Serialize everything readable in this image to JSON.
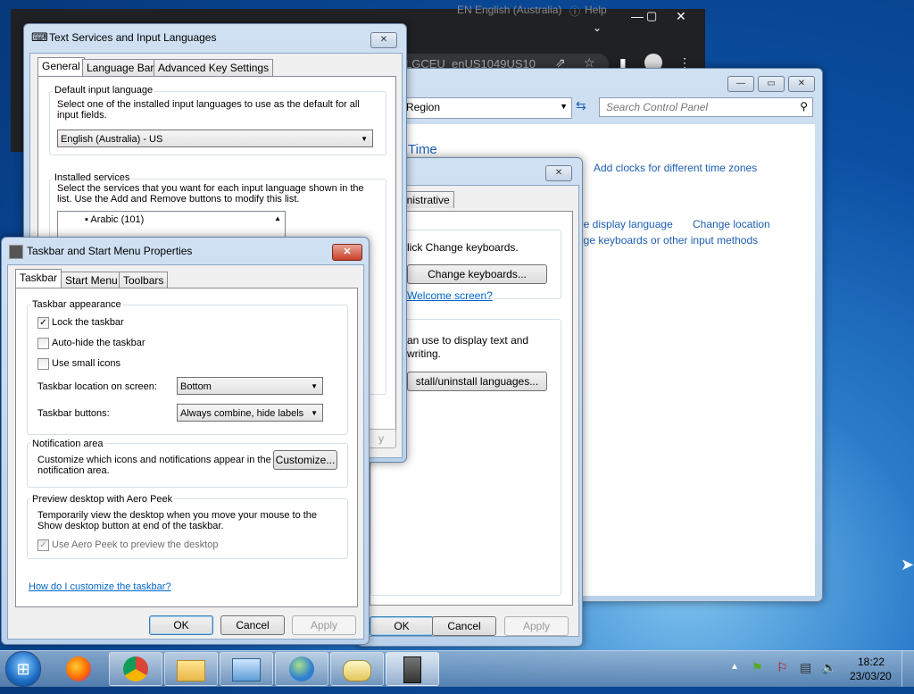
{
  "browser": {
    "language_indicator": "EN English (Australia)",
    "help_label": "Help",
    "url_fragment": "LGCEU_enUS1049US10"
  },
  "control_panel": {
    "address": "Region",
    "search_placeholder": "Search Control Panel",
    "heading": "Time",
    "links": {
      "add_clocks": "Add clocks for different time zones",
      "change_display_language": "ge display language",
      "change_location": "Change location",
      "change_keyboards": "nge keyboards or other input methods"
    }
  },
  "region_dialog": {
    "tab_partial": "inistrative",
    "text1": "lick Change keyboards.",
    "change_keyboards_btn": "Change keyboards...",
    "welcome_link": "Welcome screen?",
    "text2_line1": "an use to display text and",
    "text2_line2": "writing.",
    "install_btn": "stall/uninstall languages...",
    "ok": "OK",
    "cancel": "Cancel",
    "apply": "Apply"
  },
  "text_services": {
    "title": "Text Services and Input Languages",
    "tabs": [
      "General",
      "Language Bar",
      "Advanced Key Settings"
    ],
    "default_group": "Default input language",
    "default_desc": "Select one of the installed input languages to use as the default for all input fields.",
    "default_value": "English (Australia) - US",
    "installed_group": "Installed services",
    "installed_desc": "Select the services that you want for each input language shown in the list. Use the Add and Remove buttons to modify this list.",
    "list_item": "Arabic (101)",
    "apply_partial": "y"
  },
  "taskbar_props": {
    "title": "Taskbar and Start Menu Properties",
    "tabs": [
      "Taskbar",
      "Start Menu",
      "Toolbars"
    ],
    "appearance_group": "Taskbar appearance",
    "lock": "Lock the taskbar",
    "autohide": "Auto-hide the taskbar",
    "small_icons": "Use small icons",
    "location_label": "Taskbar location on screen:",
    "location_value": "Bottom",
    "buttons_label": "Taskbar buttons:",
    "buttons_value": "Always combine, hide labels",
    "notif_group": "Notification area",
    "notif_desc": "Customize which icons and notifications appear in the notification area.",
    "customize_btn": "Customize...",
    "peek_group": "Preview desktop with Aero Peek",
    "peek_desc": "Temporarily view the desktop when you move your mouse to the Show desktop button at end of the taskbar.",
    "peek_check": "Use Aero Peek to preview the desktop",
    "help_link": "How do I customize the taskbar?",
    "ok": "OK",
    "cancel": "Cancel",
    "apply": "Apply",
    "checks": {
      "lock": true,
      "autohide": false,
      "small_icons": false,
      "aero_peek": true
    }
  },
  "taskbar": {
    "time": "18:22",
    "date": "23/03/20",
    "icons": [
      "start-orb-icon",
      "firefox-icon",
      "chrome-icon",
      "folder-icon",
      "control-panel-icon",
      "globe-clock-icon",
      "keyboard-icon",
      "taskbar-properties-icon"
    ]
  }
}
